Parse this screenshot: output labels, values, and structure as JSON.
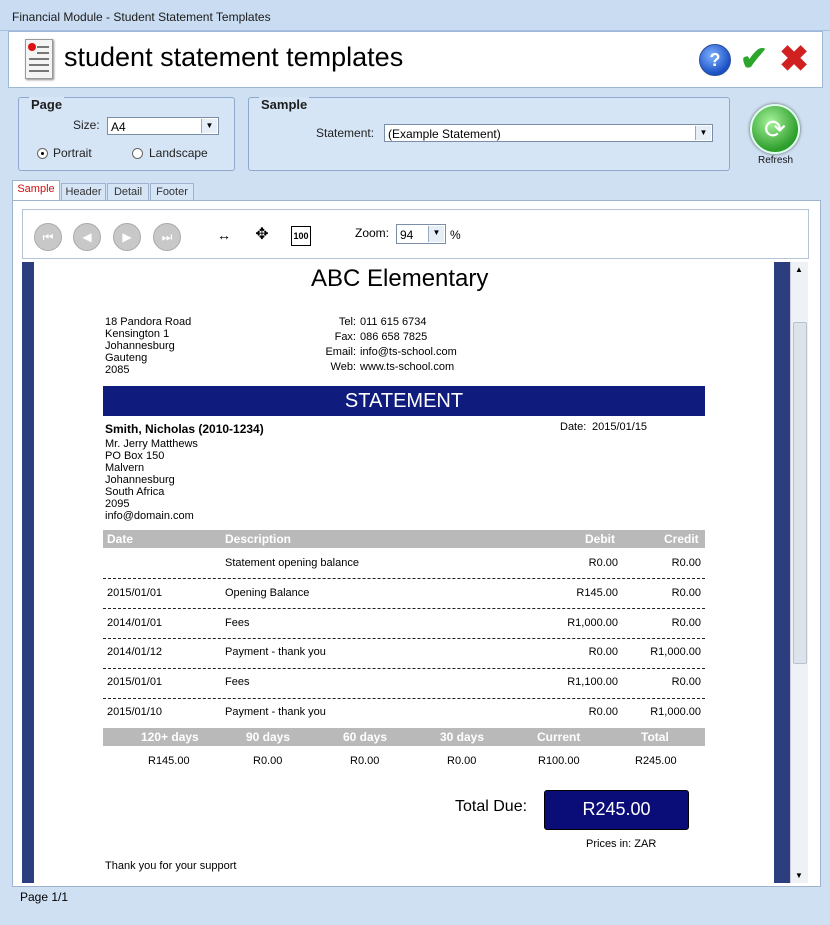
{
  "window": {
    "title": "Financial Module - Student Statement Templates"
  },
  "header": {
    "title": "student statement templates",
    "help_icon": "help-icon",
    "ok_icon": "checkmark-icon",
    "cancel_icon": "close-icon"
  },
  "page_group": {
    "title": "Page",
    "size_label": "Size:",
    "size_value": "A4",
    "portrait_label": "Portrait",
    "landscape_label": "Landscape",
    "orientation": "Portrait"
  },
  "sample_group": {
    "title": "Sample",
    "statement_label": "Statement:",
    "statement_value": "(Example Statement)"
  },
  "refresh_label": "Refresh",
  "tabs": [
    "Sample",
    "Header",
    "Detail",
    "Footer"
  ],
  "active_tab": "Sample",
  "toolbar": {
    "zoom_label": "Zoom:",
    "zoom_value": "94",
    "zoom_unit": "%",
    "actual_size_label": "100"
  },
  "statement": {
    "school": "ABC Elementary",
    "address": [
      "18 Pandora Road",
      "Kensington 1",
      "Johannesburg",
      "Gauteng",
      "2085"
    ],
    "contact": {
      "tel_label": "Tel:",
      "tel": "011 615 6734",
      "fax_label": "Fax:",
      "fax": "086 658 7825",
      "email_label": "Email:",
      "email": "info@ts-school.com",
      "web_label": "Web:",
      "web": "www.ts-school.com"
    },
    "band_title": "STATEMENT",
    "student": "Smith, Nicholas (2010-1234)",
    "date_label": "Date:",
    "date": "2015/01/15",
    "recipient": [
      "Mr. Jerry Matthews",
      "PO Box 150",
      "Malvern",
      "Johannesburg",
      "South Africa",
      "2095",
      "info@domain.com"
    ],
    "columns": [
      "Date",
      "Description",
      "Debit",
      "Credit"
    ],
    "rows": [
      {
        "date": "",
        "description": "Statement opening balance",
        "debit": "R0.00",
        "credit": "R0.00"
      },
      {
        "date": "2015/01/01",
        "description": "Opening Balance",
        "debit": "R145.00",
        "credit": "R0.00"
      },
      {
        "date": "2014/01/01",
        "description": "Fees",
        "debit": "R1,000.00",
        "credit": "R0.00"
      },
      {
        "date": "2014/01/12",
        "description": "Payment - thank you",
        "debit": "R0.00",
        "credit": "R1,000.00"
      },
      {
        "date": "2015/01/01",
        "description": "Fees",
        "debit": "R1,100.00",
        "credit": "R0.00"
      },
      {
        "date": "2015/01/10",
        "description": "Payment - thank you",
        "debit": "R0.00",
        "credit": "R1,000.00"
      }
    ],
    "aging_columns": [
      "120+ days",
      "90 days",
      "60 days",
      "30 days",
      "Current",
      "Total"
    ],
    "aging_values": [
      "R145.00",
      "R0.00",
      "R0.00",
      "R0.00",
      "R100.00",
      "R245.00"
    ],
    "total_due_label": "Total Due:",
    "total_due": "R245.00",
    "prices_in": "Prices in: ZAR",
    "footer_note": "Thank you for your support"
  },
  "status": {
    "page": "Page 1/1"
  }
}
